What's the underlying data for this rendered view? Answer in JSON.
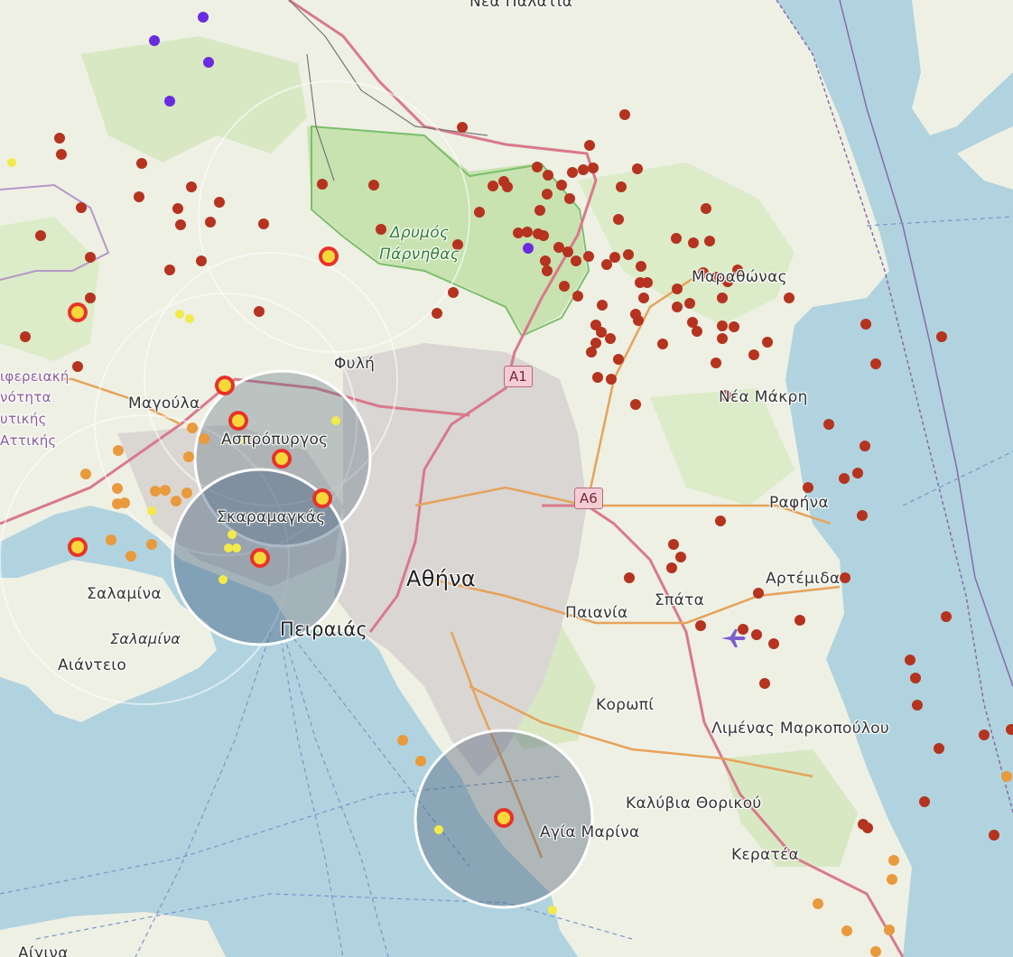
{
  "map": {
    "labels": {
      "nea_palatia": "Νέα Παλάτια",
      "drymos_1": "Δρυμός",
      "drymos_2": "Πάρνηθας",
      "marathonas": "Μαραθώνας",
      "fyli": "Φυλή",
      "nea_makri": "Νέα Μάκρη",
      "magoula": "Μαγούλα",
      "aspropyrgos": "Ασπρόπυργος",
      "skaramagkas": "Σκαραμαγκάς",
      "rafina": "Ραφήνα",
      "athina": "Αθήνα",
      "artemida": "Αρτέμιδα",
      "spata": "Σπάτα",
      "paiania": "Παιανία",
      "salamina_town": "Σαλαμίνα",
      "peiraias": "Πειραιάς",
      "salamina_island": "Σαλαμίνα",
      "aianteio": "Αιάντειο",
      "koropi": "Κορωπί",
      "limenas": "Λιμένας Μαρκοπούλου",
      "kalyvia": "Καλύβια Θορικού",
      "agia_marina": "Αγία Μαρίνα",
      "keratea": "Κερατέα",
      "aigina": "Αίγινα",
      "region_1": "ιφερειακή",
      "region_2": "νότητα",
      "region_3": "υτικής",
      "region_4": "Αττικής"
    },
    "shields": {
      "a1": "A1",
      "a6": "A6"
    },
    "marker_colors": {
      "red": "#b5331f",
      "orange": "#e89a3c",
      "yellow": "#f2ea4a",
      "purple": "#6a2ce0",
      "highlight_ring": "#e8332a",
      "highlight_core": "#f7d83a"
    },
    "icons": {
      "airport": "airplane-icon"
    }
  }
}
